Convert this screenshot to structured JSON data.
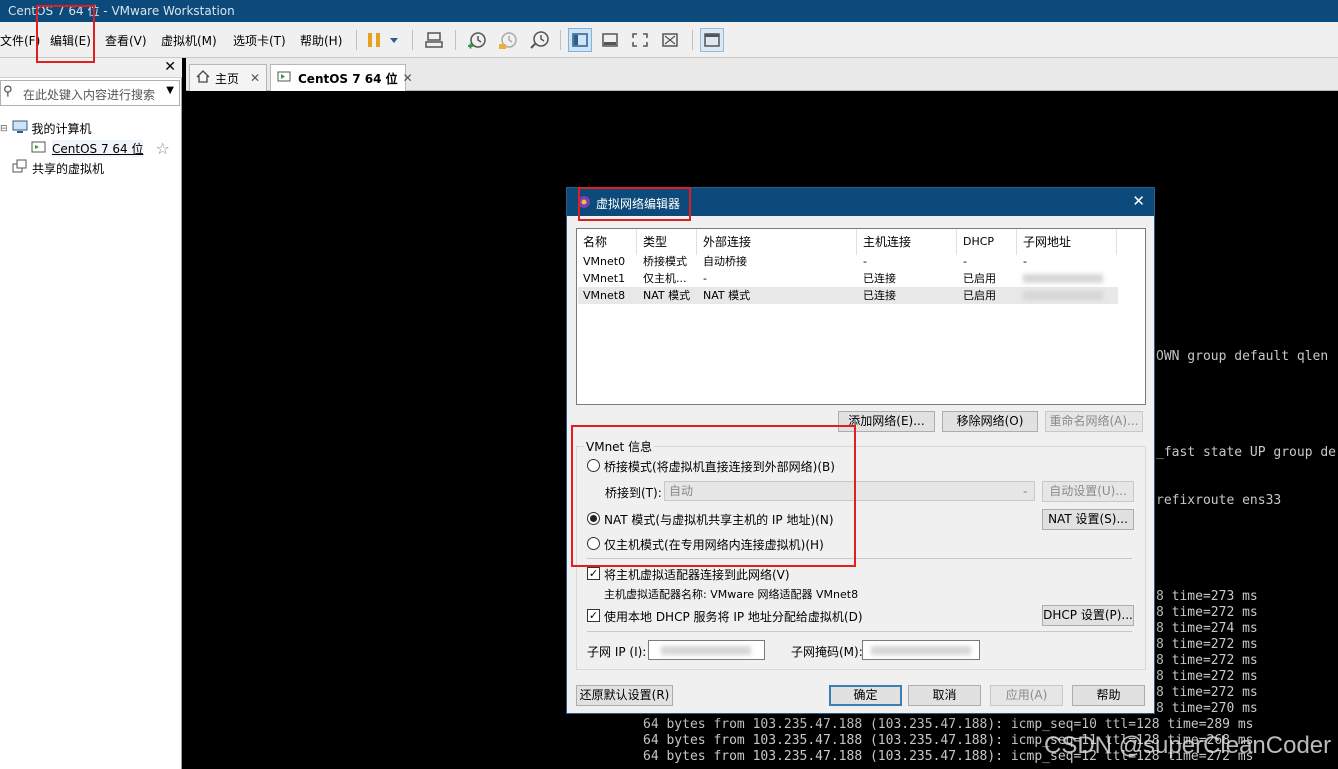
{
  "window": {
    "title": "CentOS 7 64 位 - VMware Workstation"
  },
  "menu": [
    "文件(F)",
    "编辑(E)",
    "查看(V)",
    "虚拟机(M)",
    "选项卡(T)",
    "帮助(H)"
  ],
  "toolbar_icons": [
    "pause-icon",
    "dropdown-icon",
    "send-keys-icon",
    "snapshot-icon",
    "revert-snapshot-icon",
    "snapshot-manager-icon",
    "library-view-icon",
    "thumbnail-view-icon",
    "fullscreen-icon",
    "unity-icon",
    "console-view-icon"
  ],
  "sidebar": {
    "search_placeholder": "在此处键入内容进行搜索",
    "tree": [
      {
        "label": "我的计算机"
      },
      {
        "label": "CentOS 7 64 位"
      },
      {
        "label": "共享的虚拟机"
      }
    ]
  },
  "tabs": [
    {
      "label": "主页",
      "active": false
    },
    {
      "label": "CentOS 7 64 位",
      "active": true
    }
  ],
  "terminal": {
    "right_lines": [
      "OWN group default qlen",
      "_fast state UP group de",
      "refixroute ens33"
    ],
    "ping_partial": [
      "8 time=273 ms",
      "8 time=272 ms",
      "8 time=274 ms",
      "8 time=272 ms",
      "8 time=272 ms",
      "8 time=272 ms",
      "8 time=272 ms",
      "8 time=270 ms"
    ],
    "ping_full": [
      "64 bytes from 103.235.47.188 (103.235.47.188): icmp_seq=10 ttl=128 time=289 ms",
      "64 bytes from 103.235.47.188 (103.235.47.188): icmp_seq=11 ttl=128 time=268 ms",
      "64 bytes from 103.235.47.188 (103.235.47.188): icmp_seq=12 ttl=128 time=272 ms"
    ],
    "watermark": "CSDN @superCleanCoder"
  },
  "dialog": {
    "title": "虚拟网络编辑器",
    "columns": [
      "名称",
      "类型",
      "外部连接",
      "主机连接",
      "DHCP",
      "子网地址"
    ],
    "rows": [
      [
        "VMnet0",
        "桥接模式",
        "自动桥接",
        "-",
        "-",
        "-"
      ],
      [
        "VMnet1",
        "仅主机...",
        "-",
        "已连接",
        "已启用",
        ""
      ],
      [
        "VMnet8",
        "NAT 模式",
        "NAT 模式",
        "已连接",
        "已启用",
        ""
      ]
    ],
    "buttons": {
      "add_network": "添加网络(E)...",
      "remove_network": "移除网络(O)",
      "rename_network": "重命名网络(A)...",
      "auto_settings": "自动设置(U)...",
      "nat_settings": "NAT 设置(S)...",
      "dhcp_settings": "DHCP 设置(P)...",
      "restore_defaults": "还原默认设置(R)",
      "ok": "确定",
      "cancel": "取消",
      "apply": "应用(A)",
      "help": "帮助"
    },
    "vmnet_info": {
      "group_label": "VMnet 信息",
      "bridged": "桥接模式(将虚拟机直接连接到外部网络)(B)",
      "bridge_to_label": "桥接到(T):",
      "bridge_to_value": "自动",
      "nat": "NAT 模式(与虚拟机共享主机的 IP 地址)(N)",
      "host_only": "仅主机模式(在专用网络内连接虚拟机)(H)",
      "selected_mode": "nat",
      "connect_adapter": "将主机虚拟适配器连接到此网络(V)",
      "connect_adapter_checked": true,
      "adapter_name": "主机虚拟适配器名称: VMware 网络适配器 VMnet8",
      "use_dhcp": "使用本地 DHCP 服务将 IP 地址分配给虚拟机(D)",
      "use_dhcp_checked": true,
      "subnet_ip_label": "子网 IP (I):",
      "subnet_mask_label": "子网掩码(M):"
    }
  },
  "highlight_color": "#e02020"
}
